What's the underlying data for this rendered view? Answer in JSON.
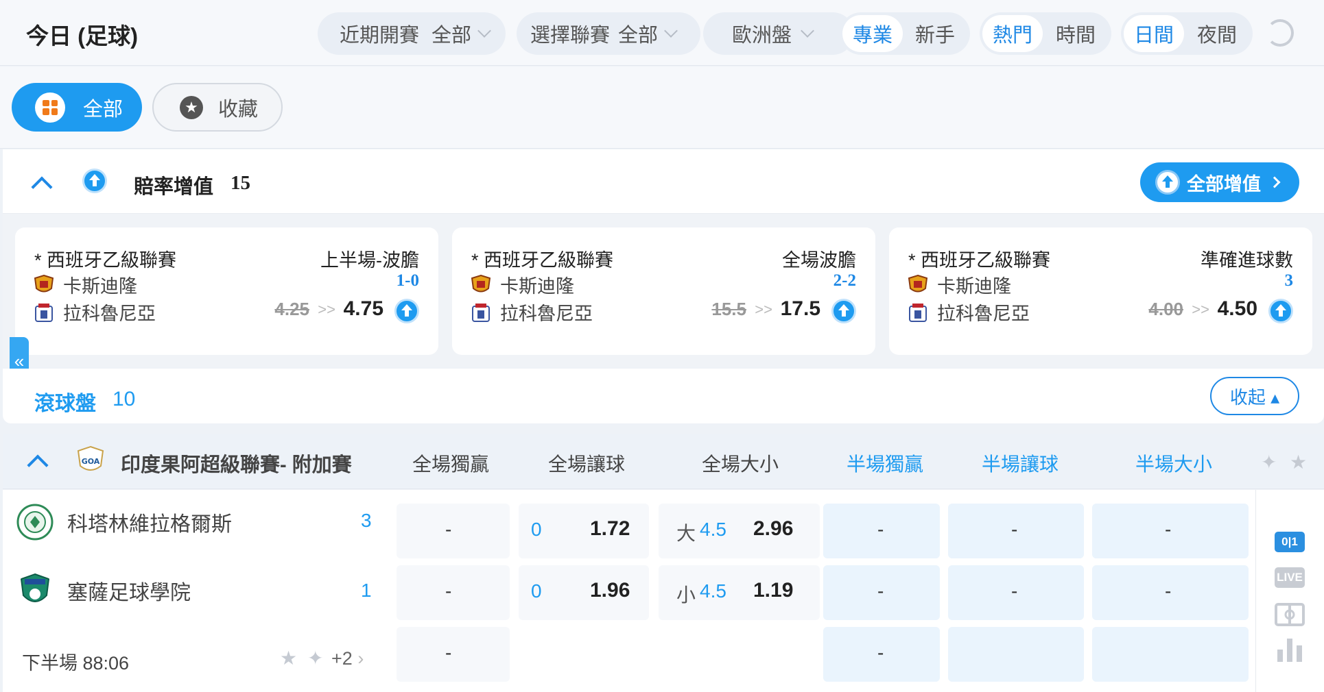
{
  "header": {
    "title": "今日 (足球)",
    "recent_label": "近期開賽",
    "recent_value": "全部",
    "league_label": "選擇聯賽",
    "league_value": "全部",
    "odds_type": "歐洲盤",
    "mode_pro": "專業",
    "mode_novice": "新手",
    "sort_hot": "熱門",
    "sort_time": "時間",
    "theme_day": "日間",
    "theme_night": "夜間"
  },
  "filters": {
    "all": "全部",
    "favorites": "收藏"
  },
  "boost": {
    "title": "賠率增值",
    "count": "15",
    "all_button": "全部增值",
    "cards": [
      {
        "league": "* 西班牙乙級聯賽",
        "market": "上半場-波膽",
        "home": "卡斯迪隆",
        "away": "拉科魯尼亞",
        "pick": "1-0",
        "old_odds": "4.25",
        "arrow": ">>",
        "new_odds": "4.75"
      },
      {
        "league": "* 西班牙乙級聯賽",
        "market": "全場波膽",
        "home": "卡斯迪隆",
        "away": "拉科魯尼亞",
        "pick": "2-2",
        "old_odds": "15.5",
        "arrow": ">>",
        "new_odds": "17.5"
      },
      {
        "league": "* 西班牙乙級聯賽",
        "market": "準確進球數",
        "home": "卡斯迪隆",
        "away": "拉科魯尼亞",
        "pick": "3",
        "old_odds": "4.00",
        "arrow": ">>",
        "new_odds": "4.50"
      }
    ]
  },
  "side_tab": "«",
  "live": {
    "title": "滾球盤",
    "count": "10",
    "collapse": "收起 ▴"
  },
  "league": {
    "name": "印度果阿超級聯賽- 附加賽",
    "columns": [
      "全場獨贏",
      "全場讓球",
      "全場大小",
      "半場獨贏",
      "半場讓球",
      "半場大小"
    ]
  },
  "match": {
    "home": {
      "name": "科塔林維拉格爾斯",
      "score": "3",
      "ml": "-",
      "hdp": "0",
      "hdp_odds": "1.72",
      "ou_side": "大",
      "ou_line": "4.5",
      "ou_odds": "2.96",
      "h_ml": "-",
      "h_hdp": "-",
      "h_ou": "-"
    },
    "away": {
      "name": "塞薩足球學院",
      "score": "1",
      "ml": "-",
      "hdp": "0",
      "hdp_odds": "1.96",
      "ou_side": "小",
      "ou_line": "4.5",
      "ou_odds": "1.19",
      "h_ml": "-",
      "h_hdp": "-",
      "h_ou": "-"
    },
    "draw": {
      "ml": "-",
      "h_ml": "-"
    },
    "period": "下半場 88:06",
    "more": "+2"
  },
  "strip": {
    "score_icon": "0|1",
    "live_icon": "LIVE"
  },
  "colors": {
    "accent": "#1e9bf0",
    "accent_dark": "#1e88e5",
    "half_cell": "#eaf4fd"
  }
}
